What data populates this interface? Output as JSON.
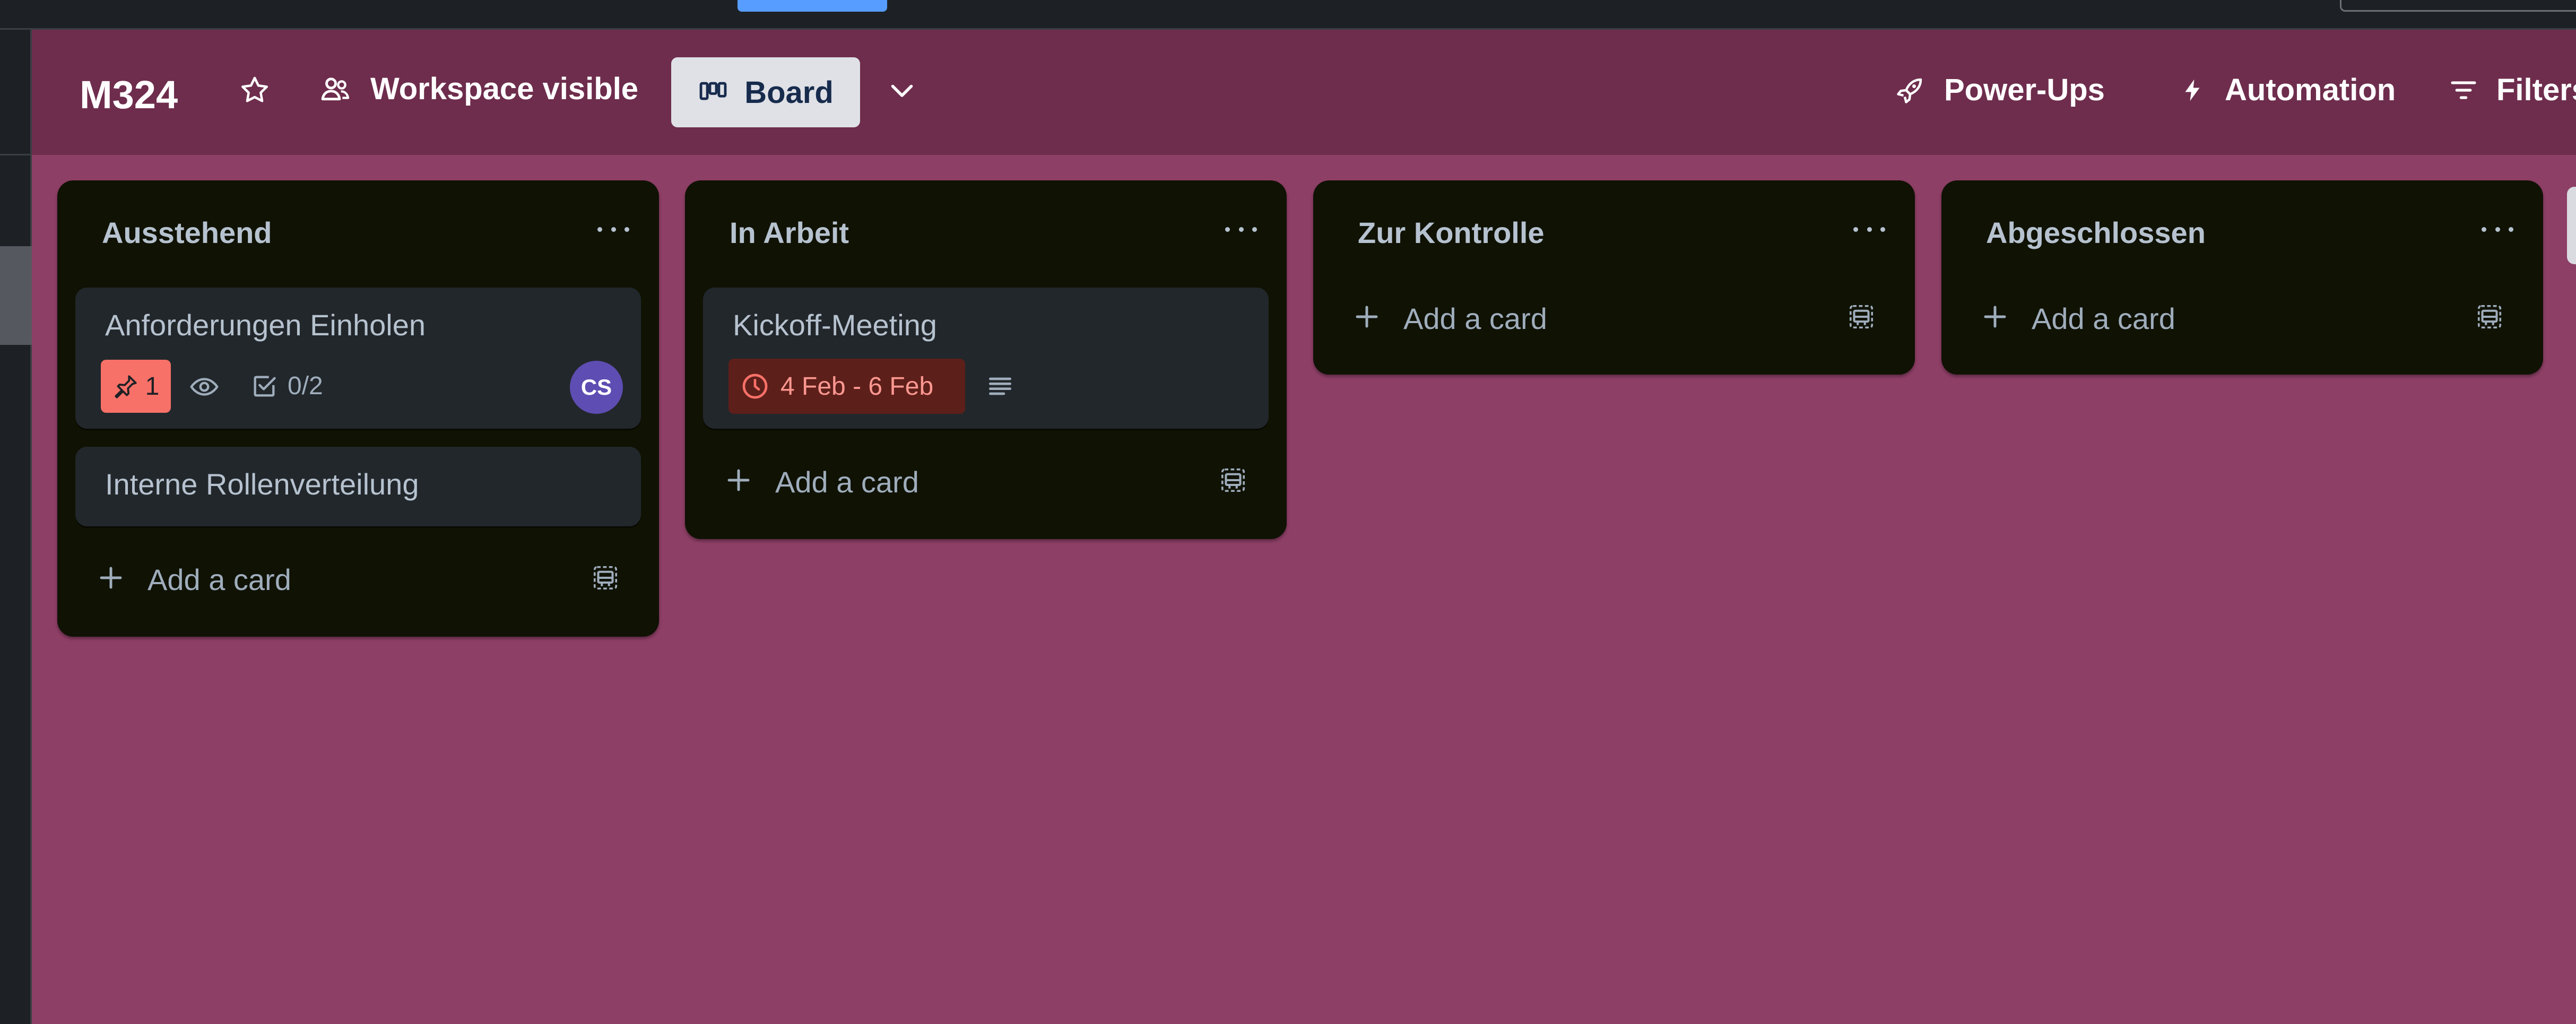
{
  "board": {
    "title": "M324",
    "visibility_label": "Workspace visible",
    "view_label": "Board"
  },
  "header_actions": {
    "powerups_label": "Power-Ups",
    "automation_label": "Automation",
    "filters_label": "Filters"
  },
  "lists": [
    {
      "title": "Ausstehend",
      "cards": [
        {
          "title": "Anforderungen Einholen",
          "notification_count": "1",
          "checklist": "0/2",
          "member_initials": "CS"
        },
        {
          "title": "Interne Rollenverteilung"
        }
      ],
      "add_label": "Add a card"
    },
    {
      "title": "In Arbeit",
      "cards": [
        {
          "title": "Kickoff-Meeting",
          "dates": "4 Feb - 6 Feb"
        }
      ],
      "add_label": "Add a card"
    },
    {
      "title": "Zur Kontrolle",
      "cards": [],
      "add_label": "Add a card"
    },
    {
      "title": "Abgeschlossen",
      "cards": [],
      "add_label": "Add a card"
    }
  ],
  "colors": {
    "board_background": "#8e3f66",
    "header_background": "#6e2d4d",
    "list_background": "#101204",
    "card_background": "#22272b",
    "overdue_badge": "#f87168",
    "date_badge_bg": "#5d1f1a",
    "date_badge_text": "#fd9891",
    "avatar": "#5e4db2",
    "topbar_accent": "#579dff"
  },
  "icons": {
    "star": "star-icon",
    "visibility": "workspace-people-icon",
    "board_view": "board-columns-icon",
    "view_switch": "chevron-down-icon",
    "powerups": "rocket-icon",
    "automation": "lightning-icon",
    "filters": "filter-lines-icon",
    "list_menu": "more-dots-icon",
    "add": "plus-icon",
    "template": "card-template-icon",
    "notification": "pin-icon",
    "watch": "eye-icon",
    "checklist": "checkbox-icon",
    "due_date": "clock-icon",
    "description": "description-icon"
  }
}
